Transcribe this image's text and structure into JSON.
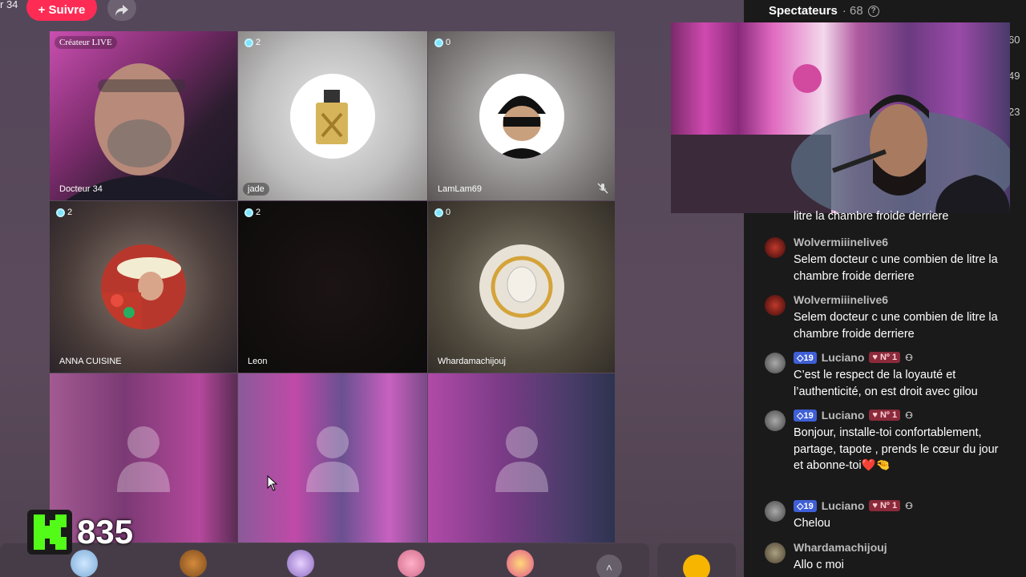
{
  "header": {
    "top_left_fragment": "r 34",
    "follow_label": "+ Suivre"
  },
  "grid": {
    "cells": [
      {
        "name": "Docteur 34",
        "tag": "Créateur LIVE",
        "count": ""
      },
      {
        "name": "jade",
        "count": "2"
      },
      {
        "name": "LamLam69",
        "count": "0"
      },
      {
        "name": "ANNA CUISINE",
        "count": "2"
      },
      {
        "name": "Leon",
        "count": "2"
      },
      {
        "name": "Whardamachijouj",
        "count": "0"
      }
    ]
  },
  "kick": {
    "viewers": "835"
  },
  "viewers_panel": {
    "title": "Spectateurs",
    "count": "· 68",
    "side_numbers": [
      "60",
      "49",
      "23"
    ]
  },
  "chat": {
    "partial_text": "litre la chambre froide derriere",
    "messages": [
      {
        "user": "Wolvermiiinelive6",
        "text": "Selem docteur c une combien de litre la chambre froide derriere"
      },
      {
        "user": "Wolvermiiinelive6",
        "text": "Selem docteur c une combien de litre la chambre froide derriere"
      },
      {
        "user": "Luciano",
        "level": "19",
        "rank": "Nº 1",
        "text": "C’est le respect de la loyauté et l’authenticité, on est droit avec gilou"
      },
      {
        "user": "Luciano",
        "level": "19",
        "rank": "Nº 1",
        "text": "Bonjour, installe-toi confortablement, partage, tapote , prends le cœur du jour et abonne-toi❤️🤏"
      },
      {
        "user": "Luciano",
        "level": "19",
        "rank": "Nº 1",
        "text": "Chelou"
      },
      {
        "user": "Whardamachijouj",
        "text": "Allo c moi"
      }
    ]
  }
}
